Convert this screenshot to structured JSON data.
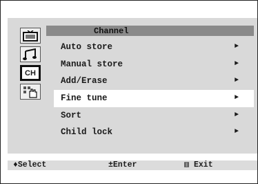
{
  "menu": {
    "title": "Channel",
    "items": [
      {
        "label": "Auto store",
        "arrow": "►"
      },
      {
        "label": "Manual store",
        "arrow": "►"
      },
      {
        "label": "Add/Erase",
        "arrow": "►"
      },
      {
        "label": "Fine tune",
        "arrow": "►",
        "selected": true
      },
      {
        "label": "Sort",
        "arrow": "►"
      },
      {
        "label": "Child lock",
        "arrow": "►"
      }
    ]
  },
  "sidebar": {
    "icons": [
      "tv-picture-icon",
      "sound-music-icon",
      "channel-icon",
      "setup-hand-icon"
    ],
    "channel_label": "CH",
    "active_index": 2
  },
  "footer": {
    "select": "♦Select",
    "enter": "±Enter",
    "exit_glyph": "▥",
    "exit": "Exit"
  },
  "colors": {
    "panel": "#d9d9d9",
    "title_bar": "#8a8a8a",
    "highlight": "#ffffff"
  }
}
